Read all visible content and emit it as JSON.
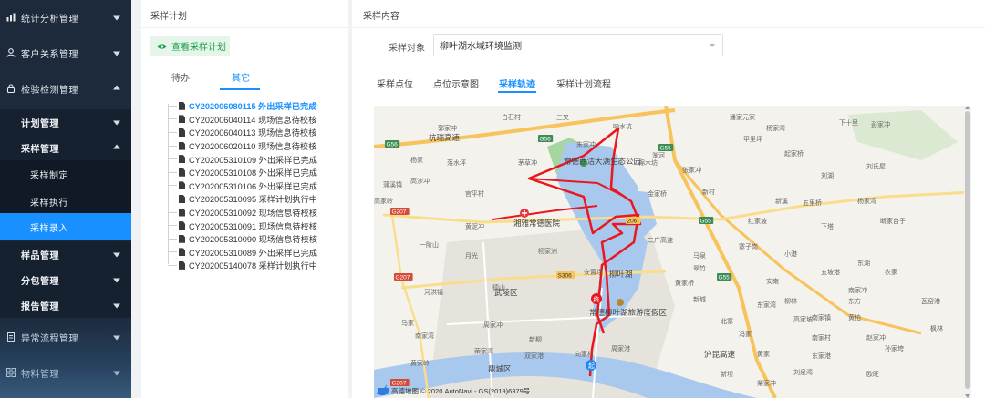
{
  "sidebar": {
    "menu": [
      {
        "label": "统计分析管理",
        "icon": "chart-icon"
      },
      {
        "label": "客户关系管理",
        "icon": "user-icon"
      },
      {
        "label": "检验检测管理",
        "icon": "lock-icon"
      }
    ],
    "plan_mgmt": "计划管理",
    "sampling_mgmt": "采样管理",
    "sampling_children": [
      "采样制定",
      "采样执行",
      "采样录入"
    ],
    "sample_mgmt": "样品管理",
    "subcontract_mgmt": "分包管理",
    "report_mgmt": "报告管理",
    "exception_mgmt": "异常流程管理",
    "material_mgmt": "物料管理",
    "bottom_icons": [
      "document-icon",
      "grid-icon"
    ]
  },
  "plan_panel": {
    "title": "采样计划",
    "view_button": "查看采样计划",
    "tabs": [
      "待办",
      "其它"
    ],
    "active_tab": "其它",
    "items": [
      "CY202006080115 外出采样已完成",
      "CY202006040114 现场信息待校核",
      "CY202006040113 现场信息待校核",
      "CY202006020110 现场信息待校核",
      "CY202005310109 外出采样已完成",
      "CY202005310108 外出采样已完成",
      "CY202005310106 外出采样已完成",
      "CY202005310095 采样计划执行中",
      "CY202005310092 现场信息待校核",
      "CY202005310091 现场信息待校核",
      "CY202005310090 现场信息待校核",
      "CY202005310089 外出采样已完成",
      "CY202005140078 采样计划执行中"
    ]
  },
  "content_panel": {
    "title": "采样内容",
    "object_label": "采样对象",
    "object_value": "柳叶湖水域环境监测",
    "tabs": [
      "采样点位",
      "点位示意图",
      "采样轨迹",
      "采样计划流程"
    ],
    "active_tab": "采样轨迹"
  },
  "map": {
    "copyright": "高德地图 © 2020 AutoNavi - GS(2019)6379号",
    "colors": {
      "water": "#a9c8ee",
      "park": "#a6d5a0",
      "road": "#f7c35c",
      "track": "#e8181e",
      "urban": "#e6e3dc"
    },
    "labels": {
      "north": [
        "白石村",
        "三叉",
        "郭家冲",
        "响水坑",
        "朱家冲",
        "渐河",
        "潘家元家",
        "下十里",
        "彭家冲",
        "杨家湾",
        "甲里坪"
      ],
      "places": [
        "杨家",
        "蒲溪镇",
        "高沙冲",
        "落水坪",
        "茅草冲",
        "棉木坊",
        "张家冲",
        "起家桥",
        "刘氏屋",
        "金家桥",
        "新村",
        "刘湖",
        "断家台子",
        "高家岭",
        "官平村",
        "新溪",
        "红家坡",
        "五里桥",
        "下塔",
        "杨家湾",
        "黄泥冲",
        "一阶山",
        "月光",
        "杨家洲",
        "安置场",
        "马泉",
        "寨子岗",
        "小港",
        "五坡港",
        "东湖",
        "农家",
        "翠竹",
        "安南"
      ],
      "south": [
        "河洪镇",
        "德山",
        "马家",
        "南家湾",
        "周家冲",
        "荣家湾",
        "双家港",
        "黄家岭",
        "新柳",
        "向家村",
        "周家港",
        "黄家桥",
        "新城",
        "北寨",
        "冯家",
        "黄家",
        "新坝",
        "柴家冲",
        "刘泉湾",
        "南家村",
        "黄柏",
        "赵家冲",
        "南家镇",
        "东方",
        "欧旺",
        "孙家垮",
        "柳林",
        "高家坡",
        "东家港",
        "东家湾",
        "南家冲",
        "瓦窑港",
        "枫林"
      ],
      "landmarks": {
        "park": "常德西沽大湖生态公园",
        "hospital": "湘雅常德医院",
        "district1": "武陵区",
        "district2": "鼎城区",
        "lake": "柳叶湖",
        "resort": "常德柳叶湖旅游度假区",
        "expressway": "杭瑞高速",
        "expressway2": "沪昆高速",
        "ring": "二广高速"
      },
      "routes": [
        "G56",
        "G56",
        "G55",
        "G55",
        "G55",
        "G207",
        "G207",
        "G207",
        "S306",
        "206"
      ]
    },
    "markers": {
      "start": "起",
      "end": "终"
    }
  }
}
